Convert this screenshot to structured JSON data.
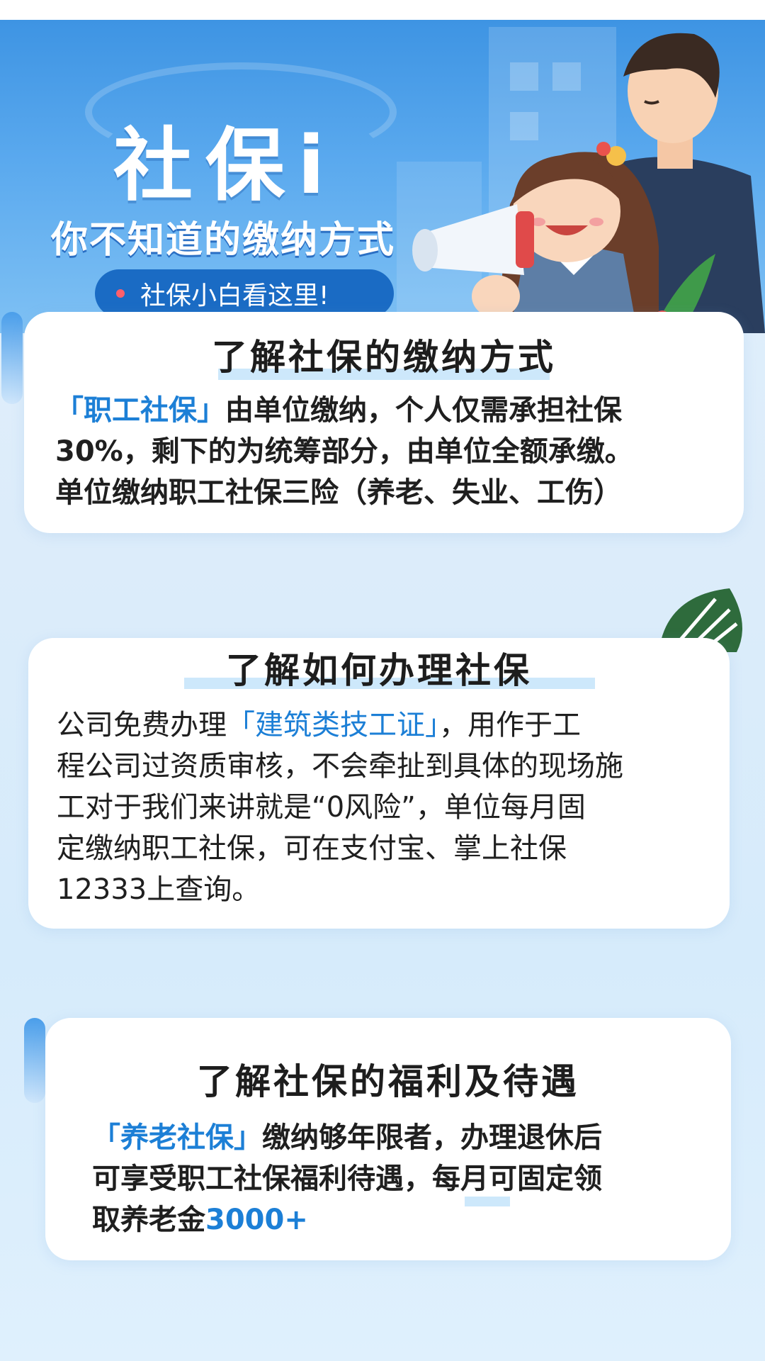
{
  "banner": {
    "title": "社保i",
    "subtitle": "你不知道的缴纳方式",
    "pill_text": "社保小白看这里!"
  },
  "sections": [
    {
      "title": "了解社保的缴纳方式",
      "lines": [
        {
          "highlight": "「职工社保」",
          "text": "由单位缴纳，个人仅需承担社保"
        },
        {
          "text": "30%，剩下的为统筹部分，由单位全额承缴。"
        },
        {
          "text": "单位缴纳职工社保三险（养老、失业、工伤）"
        }
      ]
    },
    {
      "title": "了解如何办理社保",
      "lines": [
        {
          "prefix": "公司免费办理",
          "highlight": "「建筑类技工证」",
          "text": "，用作于工"
        },
        {
          "text": "程公司过资质审核，不会牵扯到具体的现场施"
        },
        {
          "text": "工对于我们来讲就是“0风险”，单位每月固"
        },
        {
          "text": "定缴纳职工社保，可在支付宝、掌上社保"
        },
        {
          "text": "12333上查询。"
        }
      ]
    },
    {
      "title": "了解社保的福利及待遇",
      "lines": [
        {
          "highlight": "「养老社保」",
          "text": "缴纳够年限者，办理退休后"
        },
        {
          "text": "可享受职工社保福利待遇，每月可固定领"
        },
        {
          "prefix": "取养老金",
          "highlight": "3000+"
        }
      ]
    }
  ],
  "colors": {
    "accent": "#1c7fd6",
    "banner": "#3e94e3",
    "pill": "#1a6bc4",
    "highlight_bar": "#cde8fb"
  }
}
